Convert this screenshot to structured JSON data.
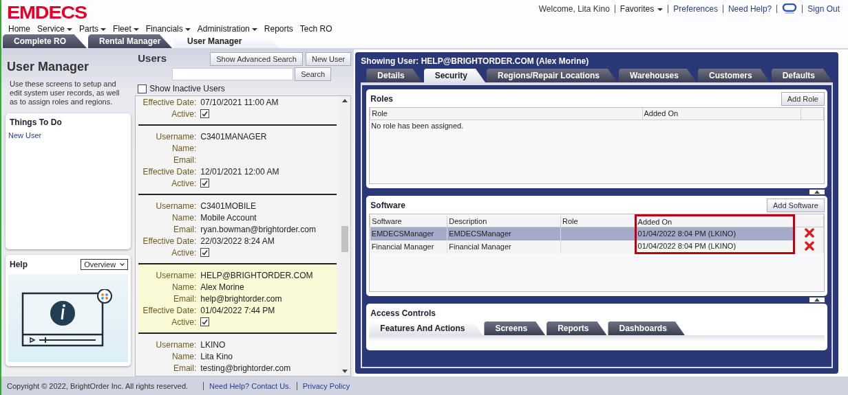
{
  "header": {
    "logo": "EMDECS",
    "welcome": "Welcome, Lita Kino",
    "links": [
      {
        "label": "Favorites",
        "has_menu": true
      },
      {
        "label": "Preferences",
        "has_menu": false
      },
      {
        "label": "Need Help?",
        "has_menu": false
      }
    ],
    "sign_out": "Sign Out"
  },
  "nav": [
    {
      "label": "Home",
      "has_menu": false
    },
    {
      "label": "Service",
      "has_menu": true
    },
    {
      "label": "Parts",
      "has_menu": true
    },
    {
      "label": "Fleet",
      "has_menu": true
    },
    {
      "label": "Financials",
      "has_menu": true
    },
    {
      "label": "Administration",
      "has_menu": true
    },
    {
      "label": "Reports",
      "has_menu": false
    },
    {
      "label": "Tech RO",
      "has_menu": false
    }
  ],
  "app_tabs": [
    {
      "label": "Complete RO",
      "selected": false
    },
    {
      "label": "Rental Manager",
      "selected": false
    },
    {
      "label": "User Manager",
      "selected": true
    }
  ],
  "sidebar": {
    "title": "User Manager",
    "description": "Use these screens to setup and edit system user records, as well as to assign roles and regions.",
    "things_to_do": {
      "title": "Things To Do",
      "items": [
        "New User"
      ]
    },
    "help": {
      "title": "Help",
      "select": "Overview"
    }
  },
  "users": {
    "title": "Users",
    "buttons": [
      "Show Advanced Search",
      "New User"
    ],
    "search_button": "Search",
    "show_inactive": {
      "label": "Show Inactive Users",
      "checked": false
    },
    "records": [
      {
        "selected": false,
        "fields": [
          {
            "kind": "text",
            "label": "Effective Date:",
            "value": "07/10/2021 11:00 AM"
          },
          {
            "kind": "checkbox",
            "label": "Active:",
            "checked": true
          }
        ]
      },
      {
        "selected": false,
        "fields": [
          {
            "kind": "text",
            "label": "Username:",
            "value": "C3401MANAGER"
          },
          {
            "kind": "text",
            "label": "Name:"
          },
          {
            "kind": "text",
            "label": "Email:"
          },
          {
            "kind": "text",
            "label": "Effective Date:",
            "value": "12/01/2021 12:00 AM"
          },
          {
            "kind": "checkbox",
            "label": "Active:",
            "checked": true
          }
        ]
      },
      {
        "selected": false,
        "fields": [
          {
            "kind": "text",
            "label": "Username:",
            "value": "C3401MOBILE"
          },
          {
            "kind": "text",
            "label": "Name:",
            "value": "Mobile Account"
          },
          {
            "kind": "text",
            "label": "Email:",
            "value": "ryan.bowman@brightorder.com"
          },
          {
            "kind": "text",
            "label": "Effective Date:",
            "value": "22/03/2022 8:24 AM"
          },
          {
            "kind": "checkbox",
            "label": "Active:",
            "checked": true
          }
        ]
      },
      {
        "selected": true,
        "fields": [
          {
            "kind": "text",
            "label": "Username:",
            "value": "HELP@BRIGHTORDER.COM"
          },
          {
            "kind": "text",
            "label": "Name:",
            "value": "Alex Morine"
          },
          {
            "kind": "text",
            "label": "Email:",
            "value": "help@brightorder.com"
          },
          {
            "kind": "text",
            "label": "Effective Date:",
            "value": "01/04/2022 7:44 PM"
          },
          {
            "kind": "checkbox",
            "label": "Active:",
            "checked": true
          }
        ]
      },
      {
        "selected": false,
        "fields": [
          {
            "kind": "text",
            "label": "Username:",
            "value": "LKINO"
          },
          {
            "kind": "text",
            "label": "Name:",
            "value": "Lita Kino"
          },
          {
            "kind": "text",
            "label": "Email:",
            "value": "testing@brightorder.com"
          }
        ]
      }
    ]
  },
  "detail": {
    "title": "Showing User: HELP@BRIGHTORDER.COM (Alex Morine)",
    "tabs": [
      {
        "label": "Details",
        "selected": false
      },
      {
        "label": "Security",
        "selected": true
      },
      {
        "label": "Regions/Repair Locations",
        "selected": false
      },
      {
        "label": "Warehouses",
        "selected": false
      },
      {
        "label": "Customers",
        "selected": false
      },
      {
        "label": "Defaults",
        "selected": false
      }
    ],
    "roles": {
      "title": "Roles",
      "button": "Add Role",
      "columns": [
        "Role",
        "Added On"
      ],
      "empty": "No role has been assigned."
    },
    "software": {
      "title": "Software",
      "button": "Add Software",
      "columns": [
        {
          "label": "Software",
          "highlighted": false
        },
        {
          "label": "Description",
          "highlighted": false
        },
        {
          "label": "Role",
          "highlighted": false
        },
        {
          "label": "Added On",
          "highlighted": true
        }
      ],
      "rows": [
        {
          "selected": true,
          "cells": [
            "EMDECSManager",
            "EMDECSManager",
            "",
            "01/04/2022 8:04 PM (LKINO)"
          ]
        },
        {
          "selected": false,
          "cells": [
            "Financial Manager",
            "Financial Manager",
            "",
            "01/04/2022 8:04 PM (LKINO)"
          ]
        }
      ]
    },
    "access": {
      "title": "Access Controls",
      "tabs": [
        {
          "label": "Features And Actions",
          "selected": true
        },
        {
          "label": "Screens",
          "selected": false
        },
        {
          "label": "Reports",
          "selected": false
        },
        {
          "label": "Dashboards",
          "selected": false
        }
      ]
    }
  },
  "footer": {
    "copyright": "Copyright © 2022, BrightOrder Inc. All rights reserved.",
    "links": [
      "Need Help? Contact Us.",
      "Privacy Policy"
    ]
  }
}
